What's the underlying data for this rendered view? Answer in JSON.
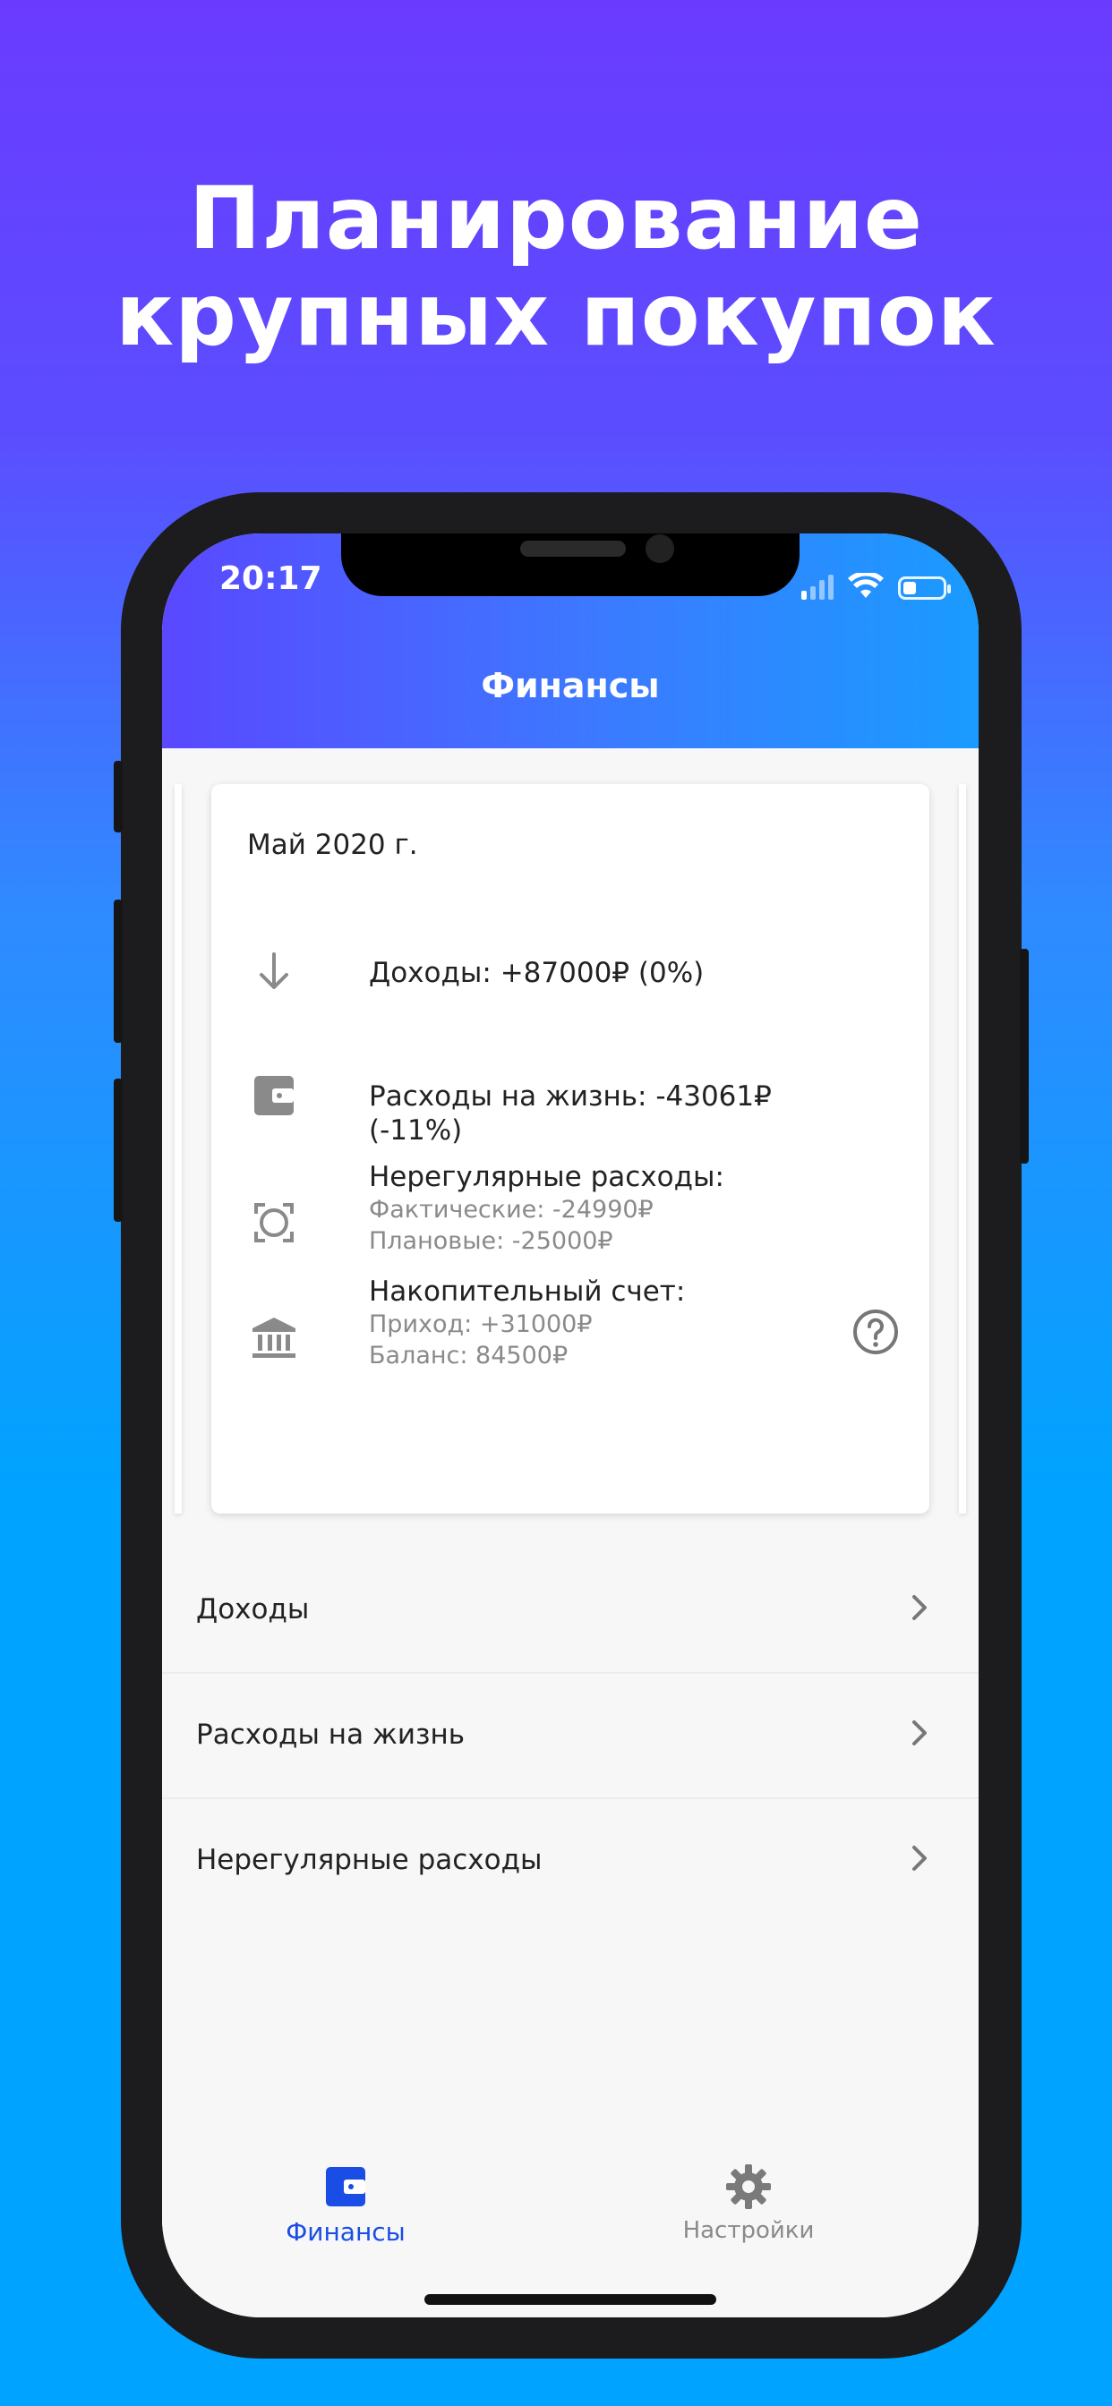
{
  "headline": {
    "line1": "Планирование",
    "line2": "крупных покупок"
  },
  "status_bar": {
    "time": "20:17"
  },
  "header": {
    "title": "Финансы"
  },
  "card": {
    "month": "Май 2020 г.",
    "income": {
      "label": "Доходы: +87000₽ (0%)",
      "icon": "arrow-down-icon"
    },
    "living_expenses": {
      "label": "Расходы на жизнь: -43061₽ (-11%)",
      "icon": "wallet-icon"
    },
    "irregular_expenses": {
      "label": "Нерегулярные расходы:",
      "actual": "Фактические: -24990₽",
      "planned": "Плановые: -25000₽",
      "icon": "focus-frame-icon"
    },
    "savings_account": {
      "label": "Накопительный счет:",
      "inflow": "Приход: +31000₽",
      "balance": "Баланс: 84500₽",
      "icon": "bank-icon",
      "help_icon": "help-circle-icon"
    }
  },
  "list": [
    {
      "label": "Доходы"
    },
    {
      "label": "Расходы на жизнь"
    },
    {
      "label": "Нерегулярные расходы"
    }
  ],
  "tabbar": {
    "finance": "Финансы",
    "settings": "Настройки"
  },
  "colors": {
    "accent": "#1a4de6",
    "header_gradient_start": "#5a48ff",
    "header_gradient_end": "#1a9bff",
    "background_top": "#6a3bff",
    "background_bottom": "#00a3ff"
  }
}
